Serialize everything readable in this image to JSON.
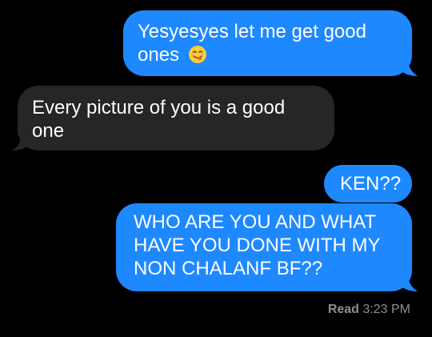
{
  "messages": [
    {
      "direction": "sent",
      "text": "Yesyesyes let me get good ones",
      "emoji": "savoring-food-face-emoji"
    },
    {
      "direction": "received",
      "text": "Every picture of you is a good one"
    },
    {
      "direction": "sent",
      "text": "KEN??"
    },
    {
      "direction": "sent",
      "text": "WHO ARE YOU AND WHAT HAVE YOU DONE WITH MY NON CHALANF BF??"
    }
  ],
  "receipt": {
    "label": "Read",
    "time": "3:23 PM"
  },
  "colors": {
    "background": "#000000",
    "sent_bubble": "#1E88FF",
    "received_bubble": "#262628",
    "receipt_text": "#8E8E93"
  }
}
